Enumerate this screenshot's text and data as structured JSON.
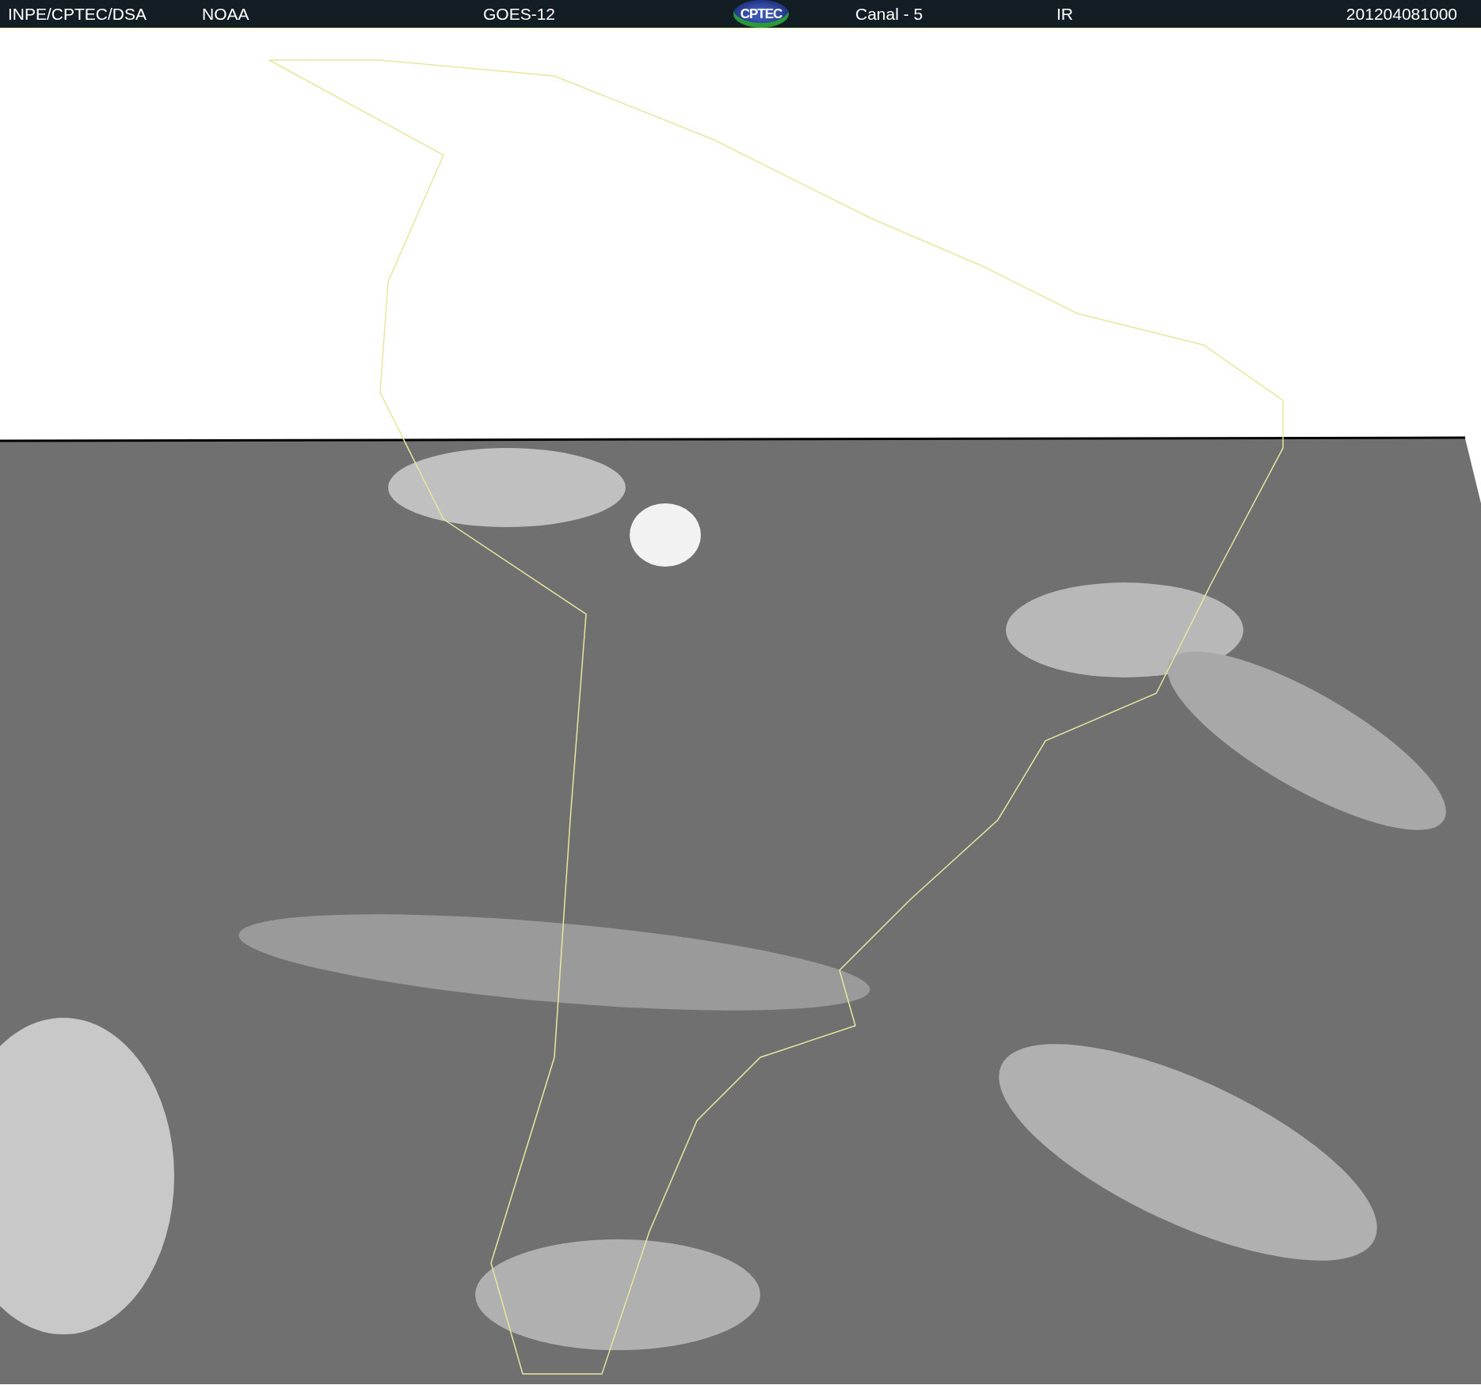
{
  "header": {
    "source": "INPE/CPTEC/DSA",
    "agency": "NOAA",
    "satellite": "GOES-12",
    "logo": "CPTEC",
    "channel": "Canal - 5",
    "band": "IR",
    "timestamp": "201204081000"
  }
}
